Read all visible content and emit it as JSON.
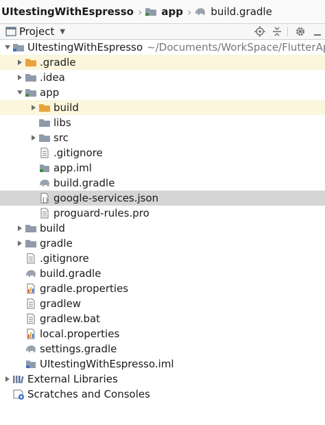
{
  "breadcrumb": {
    "items": [
      "UItestingWithEspresso",
      "app",
      "build.gradle"
    ]
  },
  "toolwindow": {
    "title": "Project"
  },
  "tree": [
    {
      "label": "UItestingWithEspresso",
      "path": "~/Documents/WorkSpace/FlutterAp",
      "icon": "module-folder-icon",
      "expand": "expanded"
    },
    {
      "label": ".gradle",
      "icon": "orange-folder-icon",
      "expand": "collapsed",
      "highlight": "yellow"
    },
    {
      "label": ".idea",
      "icon": "folder-icon",
      "expand": "collapsed"
    },
    {
      "label": "app",
      "icon": "module-folder-icon",
      "expand": "expanded"
    },
    {
      "label": "build",
      "icon": "orange-folder-icon",
      "expand": "collapsed",
      "highlight": "yellow"
    },
    {
      "label": "libs",
      "icon": "folder-icon",
      "expand": "none"
    },
    {
      "label": "src",
      "icon": "folder-icon",
      "expand": "collapsed"
    },
    {
      "label": ".gitignore",
      "icon": "text-file-icon",
      "expand": "none"
    },
    {
      "label": "app.iml",
      "icon": "iml-file-icon",
      "expand": "none"
    },
    {
      "label": "build.gradle",
      "icon": "gradle-elephant-icon",
      "expand": "none"
    },
    {
      "label": "google-services.json",
      "icon": "json-file-icon",
      "expand": "none",
      "highlight": "gray"
    },
    {
      "label": "proguard-rules.pro",
      "icon": "text-file-icon",
      "expand": "none"
    },
    {
      "label": "build",
      "icon": "folder-icon",
      "expand": "collapsed"
    },
    {
      "label": "gradle",
      "icon": "folder-icon",
      "expand": "collapsed"
    },
    {
      "label": ".gitignore",
      "icon": "text-file-icon",
      "expand": "none"
    },
    {
      "label": "build.gradle",
      "icon": "gradle-elephant-icon",
      "expand": "none"
    },
    {
      "label": "gradle.properties",
      "icon": "properties-file-icon",
      "expand": "none"
    },
    {
      "label": "gradlew",
      "icon": "text-file-icon",
      "expand": "none"
    },
    {
      "label": "gradlew.bat",
      "icon": "text-file-icon",
      "expand": "none"
    },
    {
      "label": "local.properties",
      "icon": "properties-file-icon",
      "expand": "none"
    },
    {
      "label": "settings.gradle",
      "icon": "gradle-elephant-icon",
      "expand": "none"
    },
    {
      "label": "UItestingWithEspresso.iml",
      "icon": "iml-file-icon",
      "expand": "none"
    },
    {
      "label": "External Libraries",
      "icon": "libraries-icon",
      "expand": "collapsed"
    },
    {
      "label": "Scratches and Consoles",
      "icon": "scratches-icon",
      "expand": "none"
    }
  ],
  "colors": {
    "selection_highlight": "#d5d5d5",
    "excluded_highlight": "#fbf6dc",
    "excluded_folder": "#e9a23b",
    "folder": "#8f9bab"
  }
}
